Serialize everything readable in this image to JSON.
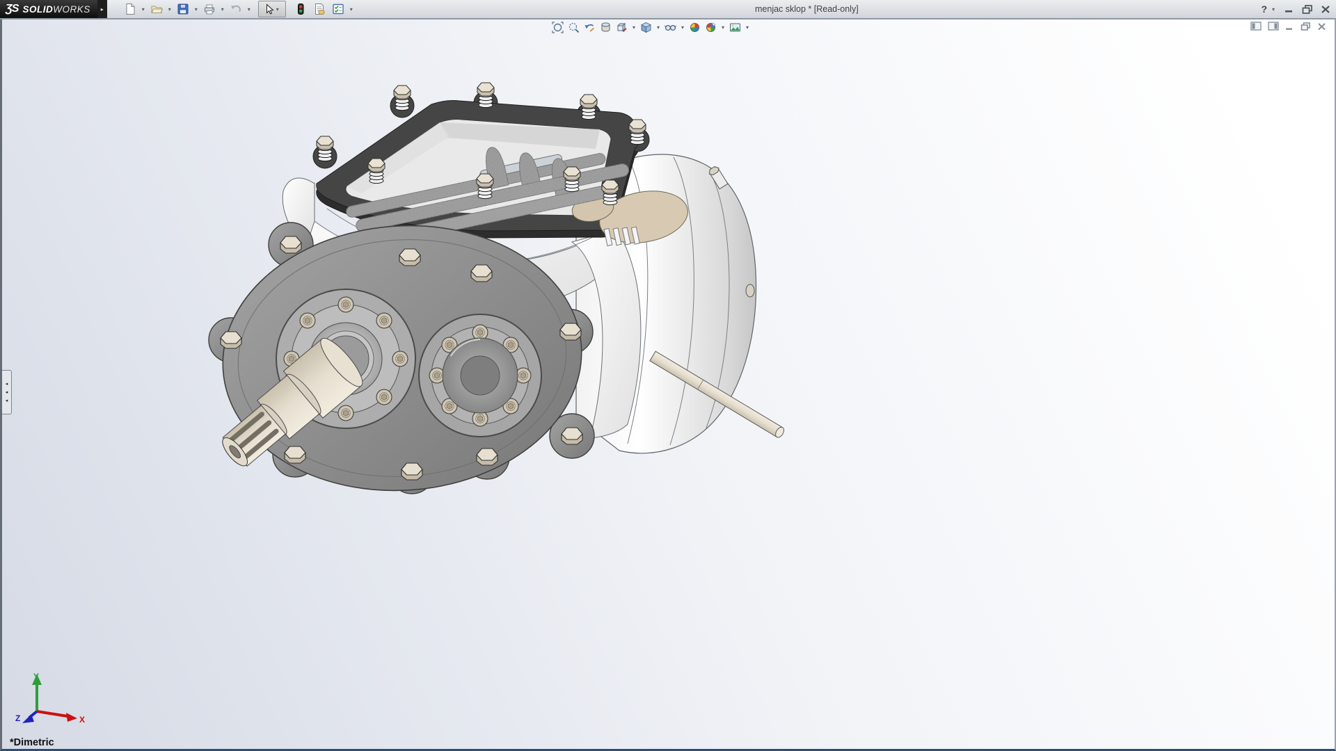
{
  "app": {
    "window_title": "menjac sklop * [Read-only]",
    "logo_glyph": "ƷS",
    "brand_bold": "SOLID",
    "brand_light": "WORKS",
    "expander_glyph": "▸",
    "read_only": true
  },
  "glyphs": {
    "caret": "▾",
    "help": "?",
    "collapse_arrow": "◂"
  },
  "standard_toolbar": {
    "items": [
      {
        "name": "new",
        "icon": "new-document-icon",
        "caret": true
      },
      {
        "name": "open",
        "icon": "open-folder-icon",
        "caret": true
      },
      {
        "name": "save",
        "icon": "save-icon",
        "caret": true
      },
      {
        "name": "print",
        "icon": "print-icon",
        "caret": true
      },
      {
        "name": "undo",
        "icon": "undo-icon",
        "caret": true
      },
      {
        "name": "select",
        "icon": "select-cursor-icon",
        "caret": true,
        "pressed": true
      },
      {
        "name": "rebuild",
        "icon": "traffic-light-icon",
        "caret": false
      },
      {
        "name": "file-properties",
        "icon": "file-properties-icon",
        "caret": false
      },
      {
        "name": "options",
        "icon": "options-checklist-icon",
        "caret": true
      }
    ]
  },
  "heads_up_toolbar": {
    "items": [
      {
        "name": "zoom-to-fit",
        "icon": "zoom-to-fit-icon",
        "caret": false
      },
      {
        "name": "zoom-to-area",
        "icon": "zoom-to-area-icon",
        "caret": false
      },
      {
        "name": "previous-view",
        "icon": "previous-view-icon",
        "caret": false
      },
      {
        "name": "section-view",
        "icon": "section-view-icon",
        "caret": false
      },
      {
        "name": "3d-drawing-view",
        "icon": "3d-drawing-view-icon",
        "caret": true
      },
      {
        "name": "view-orientation",
        "icon": "view-cube-icon",
        "caret": true
      },
      {
        "name": "display-style",
        "icon": "display-style-icon",
        "caret": true
      },
      {
        "name": "edit-appearance",
        "icon": "edit-appearance-sphere-icon",
        "caret": false
      },
      {
        "name": "apply-scene",
        "icon": "apply-scene-sphere-icon",
        "caret": true
      },
      {
        "name": "view-settings",
        "icon": "view-settings-icon",
        "caret": true
      }
    ]
  },
  "title_bar_controls": [
    {
      "name": "help",
      "caret": true
    },
    {
      "name": "minimize"
    },
    {
      "name": "restore"
    },
    {
      "name": "close"
    }
  ],
  "document_controls": [
    {
      "name": "pane-toggle-left"
    },
    {
      "name": "pane-toggle-right"
    },
    {
      "name": "minimize-document"
    },
    {
      "name": "restore-document"
    },
    {
      "name": "close-document"
    }
  ],
  "featuremanager": {
    "collapsed": true,
    "arrow_count": 3
  },
  "viewport": {
    "view_orientation_label": "*Dimetric",
    "triad": {
      "labels": {
        "x": "X",
        "y": "Y",
        "z": "Z"
      },
      "colors": {
        "x": "#cc1111",
        "y": "#2f9e3a",
        "z": "#2222bb"
      }
    }
  },
  "model": {
    "document_name": "menjac sklop",
    "type": "assembly",
    "appearance": {
      "body": "#f4f4f4",
      "flange": "#8f8f8f",
      "gasket": "#454545",
      "bolts": "#e7dfcf",
      "shaft": "#eae3d4",
      "internals": "#9a9a9a",
      "gear": "#d8cab2"
    }
  },
  "colors": {
    "titlebar_bg": "#d9dce1",
    "logo_bg": "#111111",
    "viewport_top_right": "#ffffff",
    "viewport_bottom_left": "#d5dae5",
    "frame_bottom": "#2f4d6e"
  }
}
